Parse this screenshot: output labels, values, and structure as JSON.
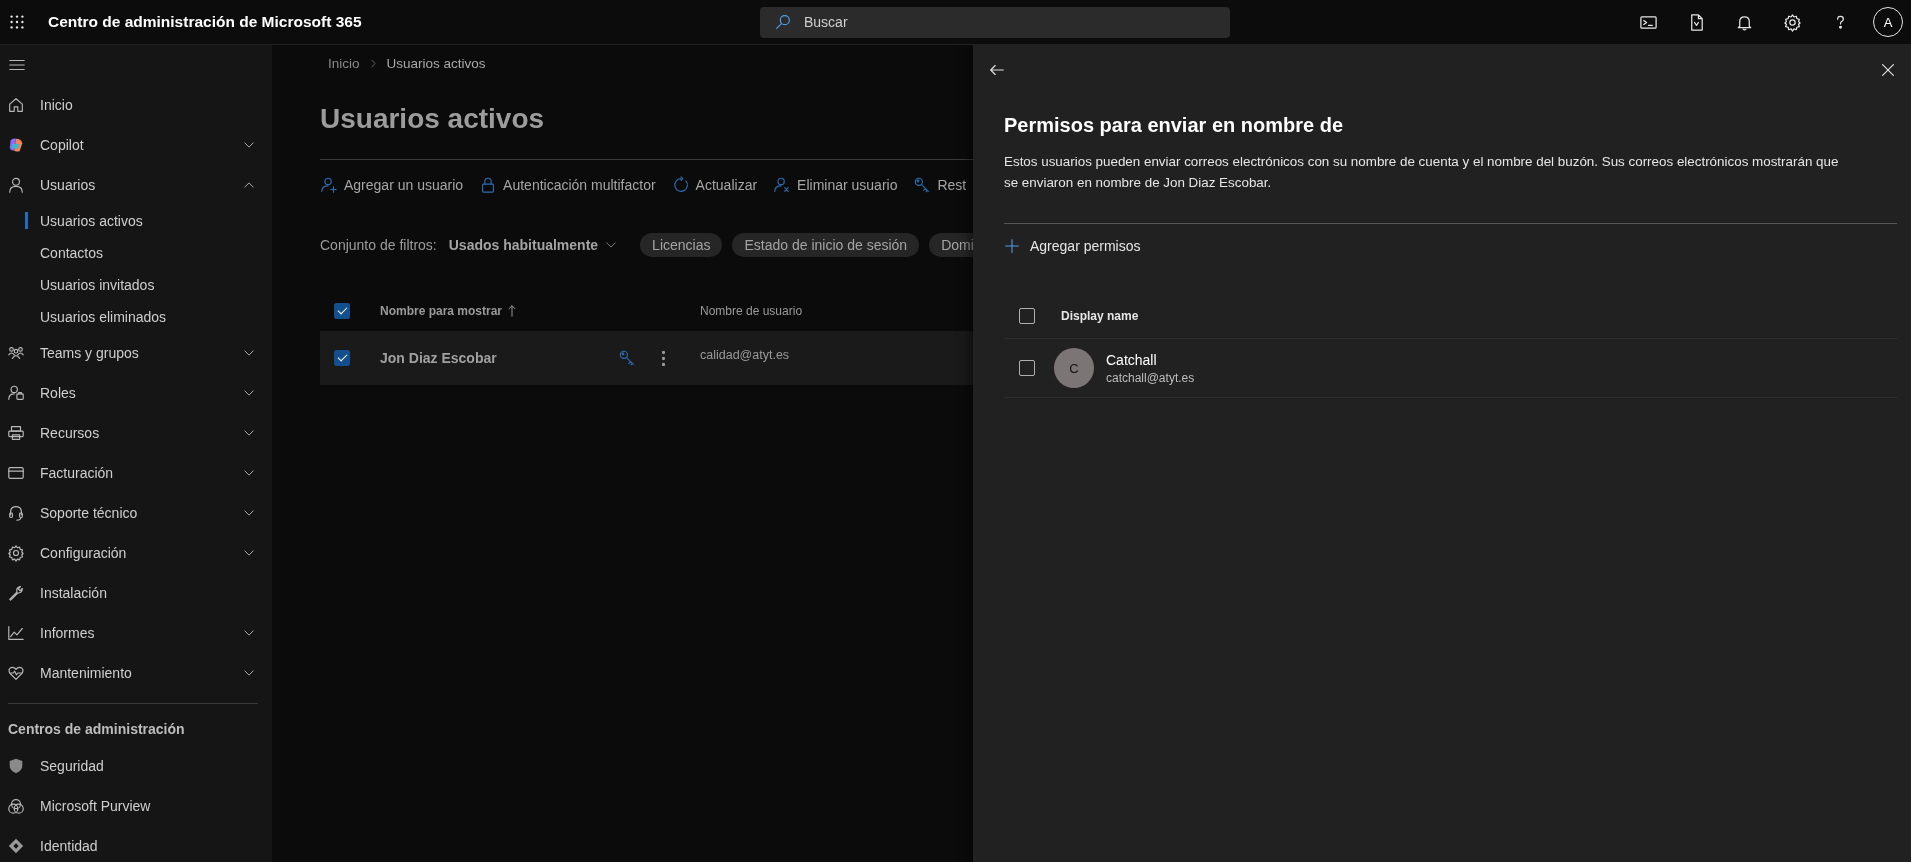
{
  "top_bar": {
    "app_title": "Centro de administración de Microsoft 365",
    "search": {
      "placeholder": "Buscar"
    },
    "avatar": "A"
  },
  "sidebar": {
    "items": [
      {
        "kind": "link",
        "label": "Inicio"
      },
      {
        "kind": "group",
        "label": "Copilot",
        "expanded": false
      },
      {
        "kind": "group",
        "label": "Usuarios",
        "expanded": true,
        "children": [
          {
            "label": "Usuarios activos",
            "selected": true
          },
          {
            "label": "Contactos",
            "selected": false
          },
          {
            "label": "Usuarios invitados",
            "selected": false
          },
          {
            "label": "Usuarios eliminados",
            "selected": false
          }
        ]
      },
      {
        "kind": "group",
        "label": "Teams y grupos",
        "expanded": false
      },
      {
        "kind": "group",
        "label": "Roles",
        "expanded": false
      },
      {
        "kind": "group",
        "label": "Recursos",
        "expanded": false
      },
      {
        "kind": "group",
        "label": "Facturación",
        "expanded": false
      },
      {
        "kind": "group",
        "label": "Soporte técnico",
        "expanded": false
      },
      {
        "kind": "group",
        "label": "Configuración",
        "expanded": false
      },
      {
        "kind": "link",
        "label": "Instalación"
      },
      {
        "kind": "group",
        "label": "Informes",
        "expanded": false
      },
      {
        "kind": "group",
        "label": "Mantenimiento",
        "expanded": false
      }
    ],
    "section_title": "Centros de administración",
    "admin_centers": [
      {
        "label": "Seguridad"
      },
      {
        "label": "Microsoft Purview"
      },
      {
        "label": "Identidad"
      }
    ]
  },
  "main": {
    "breadcrumb": [
      "Inicio",
      "Usuarios activos"
    ],
    "title": "Usuarios activos",
    "commands": [
      {
        "label": "Agregar un usuario"
      },
      {
        "label": "Autenticación multifactor"
      },
      {
        "label": "Actualizar"
      },
      {
        "label": "Eliminar usuario"
      },
      {
        "label": "Rest"
      }
    ],
    "filters": {
      "label": "Conjunto de filtros:",
      "value": "Usados habitualmente",
      "chips": [
        "Licencias",
        "Estado de inicio de sesión",
        "Domi"
      ]
    },
    "table": {
      "all_checked": true,
      "columns": [
        {
          "label": "Nombre para mostrar",
          "sorted": true
        },
        {
          "label": "Nombre de usuario",
          "sorted": false
        }
      ],
      "rows": [
        {
          "checked": true,
          "name": "Jon Diaz Escobar",
          "username": "calidad@atyt.es"
        }
      ]
    }
  },
  "panel": {
    "title": "Permisos para enviar en nombre de",
    "description": "Estos usuarios pueden enviar correos electrónicos con su nombre de cuenta y el nombre del buzón. Sus correos electrónicos mostrarán que se enviaron en nombre de Jon Diaz Escobar.",
    "add_label": "Agregar permisos",
    "list": {
      "all_checked": false,
      "column": "Display name",
      "rows": [
        {
          "checked": false,
          "initial": "C",
          "name": "Catchall",
          "email": "catchall@atyt.es"
        }
      ]
    }
  }
}
